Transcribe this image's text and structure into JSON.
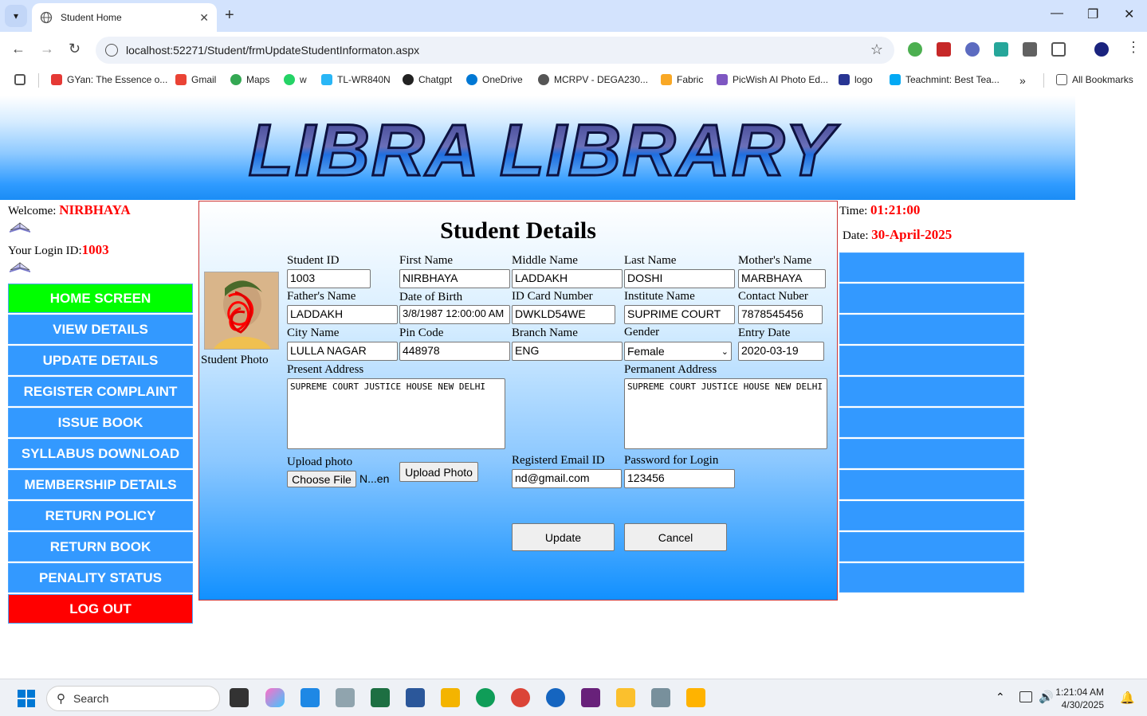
{
  "browser": {
    "tab_title": "Student Home",
    "url": "localhost:52271/Student/frmUpdateStudentInformaton.aspx",
    "bookmarks": [
      {
        "label": "GYan: The Essence o..."
      },
      {
        "label": "Gmail"
      },
      {
        "label": "Maps"
      },
      {
        "label": "w"
      },
      {
        "label": "TL-WR840N"
      },
      {
        "label": "Chatgpt"
      },
      {
        "label": "OneDrive"
      },
      {
        "label": "MCRPV - DEGA230..."
      },
      {
        "label": "Fabric"
      },
      {
        "label": "PicWish AI Photo Ed..."
      },
      {
        "label": "logo"
      },
      {
        "label": "Teachmint: Best Tea..."
      }
    ],
    "all_bookmarks": "All Bookmarks"
  },
  "banner": {
    "logo_text": "LIBRA LIBRARY"
  },
  "left": {
    "welcome_label": "Welcome: ",
    "welcome_name": "NIRBHAYA",
    "login_label": "Your Login ID:",
    "login_id": "1003",
    "menu": [
      {
        "label": "HOME SCREEN"
      },
      {
        "label": "VIEW DETAILS"
      },
      {
        "label": "UPDATE DETAILS"
      },
      {
        "label": "REGISTER COMPLAINT"
      },
      {
        "label": "ISSUE BOOK"
      },
      {
        "label": "SYLLABUS DOWNLOAD"
      },
      {
        "label": "MEMBERSHIP DETAILS"
      },
      {
        "label": "RETURN POLICY"
      },
      {
        "label": "RETURN BOOK"
      },
      {
        "label": "PENALITY STATUS"
      },
      {
        "label": "LOG OUT"
      }
    ]
  },
  "form": {
    "title": "Student Details",
    "photo_caption": "Student Photo",
    "labels": {
      "student_id": "Student ID",
      "first_name": "First Name",
      "middle_name": "Middle Name",
      "last_name": "Last Name",
      "mothers_name": "Mother's Name",
      "fathers_name": "Father's Name",
      "dob": "Date of Birth",
      "id_card": "ID Card Number",
      "institute": "Institute Name",
      "contact": "Contact Nuber",
      "city": "City Name",
      "pin": "Pin Code",
      "branch": "Branch Name",
      "gender": "Gender",
      "entry_date": "Entry Date",
      "present_address": "Present Address",
      "permanent_address": "Permanent Address",
      "upload_photo": "Upload photo",
      "email": "Registerd Email ID",
      "password": "Password for Login"
    },
    "values": {
      "student_id": "1003",
      "first_name": "NIRBHAYA",
      "middle_name": "LADDAKH",
      "last_name": "DOSHI",
      "mothers_name": "MARBHAYA",
      "fathers_name": "LADDAKH",
      "dob": "3/8/1987 12:00:00 AM",
      "id_card": "DWKLD54WE",
      "institute": "SUPRIME COURT",
      "contact": "7878545456",
      "city": "LULLA NAGAR",
      "pin": "448978",
      "branch": "ENG",
      "gender": "Female",
      "entry_date": "2020-03-19",
      "present_address": "SUPREME COURT JUSTICE HOUSE NEW DELHI",
      "permanent_address": "SUPREME COURT JUSTICE HOUSE NEW DELHI",
      "email": "nd@gmail.com",
      "password": "123456",
      "file_status": "N...en"
    },
    "buttons": {
      "choose_file": "Choose File",
      "upload_photo": "Upload Photo",
      "update": "Update",
      "cancel": "Cancel"
    }
  },
  "right": {
    "time_label": "Time: ",
    "time_value": "01:21:00",
    "date_label": "Date: ",
    "date_value": "30-April-2025"
  },
  "taskbar": {
    "search_placeholder": "Search",
    "time": "1:21:04 AM",
    "date": "4/30/2025"
  }
}
